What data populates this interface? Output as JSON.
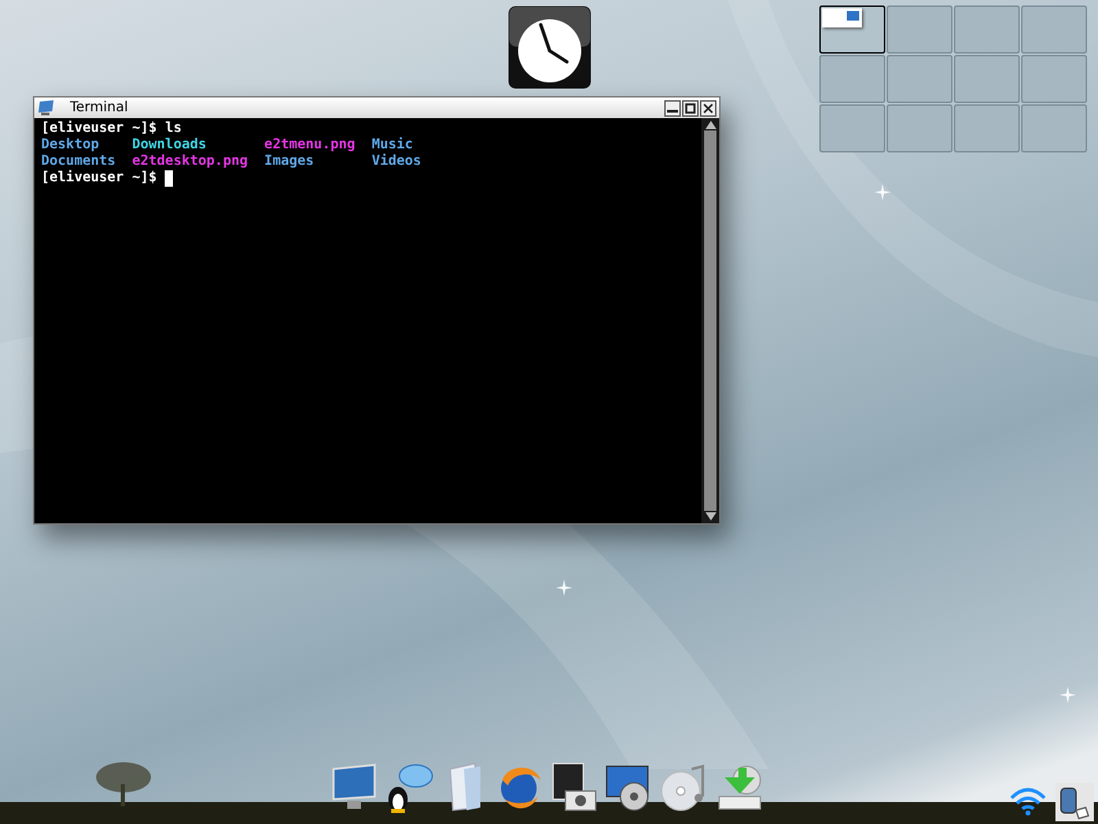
{
  "terminal": {
    "title": "Terminal",
    "lines": [
      {
        "kind": "prompt",
        "prompt": "[eliveuser ~]$",
        "command": "ls",
        "cursor": false
      },
      {
        "kind": "listing",
        "items": [
          {
            "text": "Desktop",
            "color": "#5fa8e8"
          },
          {
            "text": "Downloads",
            "color": "#3fd6e6"
          },
          {
            "text": "e2tmenu.png",
            "color": "#e436e4"
          },
          {
            "text": "Music",
            "color": "#5fa8e8"
          },
          {
            "text": "Documents",
            "color": "#5fa8e8"
          },
          {
            "text": "e2tdesktop.png",
            "color": "#e436e4"
          },
          {
            "text": "Images",
            "color": "#5fa8e8"
          },
          {
            "text": "Videos",
            "color": "#5fa8e8"
          }
        ]
      },
      {
        "kind": "prompt",
        "prompt": "[eliveuser ~]$",
        "cursor": true
      }
    ]
  },
  "pager": {
    "desks": [
      {
        "selected": true,
        "has_window": true
      },
      {
        "selected": false,
        "has_window": false
      },
      {
        "selected": false,
        "has_window": false
      },
      {
        "selected": false,
        "has_window": false
      },
      {
        "selected": false,
        "has_window": false
      },
      {
        "selected": false,
        "has_window": false
      },
      {
        "selected": false,
        "has_window": false
      },
      {
        "selected": false,
        "has_window": false
      },
      {
        "selected": false,
        "has_window": false
      },
      {
        "selected": false,
        "has_window": false
      },
      {
        "selected": false,
        "has_window": false
      },
      {
        "selected": false,
        "has_window": false
      }
    ]
  }
}
